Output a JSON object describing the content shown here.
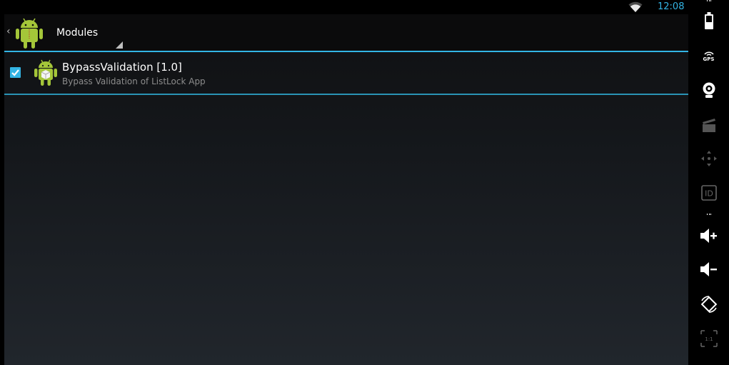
{
  "status_bar": {
    "time": "12:08"
  },
  "action_bar": {
    "title": "Modules"
  },
  "modules": [
    {
      "name": "BypassValidation [1.0]",
      "description": "Bypass Validation of ListLock App",
      "enabled": true
    }
  ],
  "emulator_toolbar": {
    "gps_label": "GPS",
    "id_label": "ID",
    "scale_label": "1:1",
    "icons": [
      "battery-icon",
      "gps-icon",
      "webcam-icon",
      "media-icon",
      "move-icon",
      "id-icon",
      "volume-up-icon",
      "volume-down-icon",
      "rotate-icon",
      "scale-icon"
    ]
  },
  "colors": {
    "accent": "#33b5e5",
    "android_green": "#a4c639"
  }
}
